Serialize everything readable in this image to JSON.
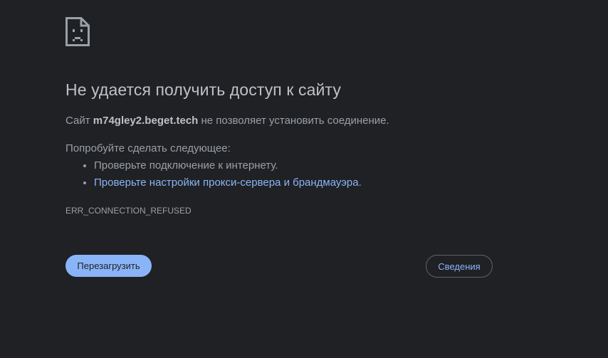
{
  "icon": "sad-page-icon",
  "title": "Не удается получить доступ к сайту",
  "description": {
    "prefix": "Сайт",
    "host": "m74gley2.beget.tech",
    "suffix": "не позволяет установить соединение."
  },
  "suggestions": {
    "heading": "Попробуйте сделать следующее:",
    "items": [
      {
        "text": "Проверьте подключение к интернету.",
        "link": ""
      },
      {
        "text": "",
        "link": "Проверьте настройки прокси-сервера и брандмауэра",
        "after": "."
      }
    ]
  },
  "error_code": "ERR_CONNECTION_REFUSED",
  "buttons": {
    "reload": "Перезагрузить",
    "details": "Сведения"
  },
  "colors": {
    "background": "#202124",
    "accent": "#8ab4f8",
    "text": "#9aa0a6",
    "title": "#bdc1c6"
  }
}
